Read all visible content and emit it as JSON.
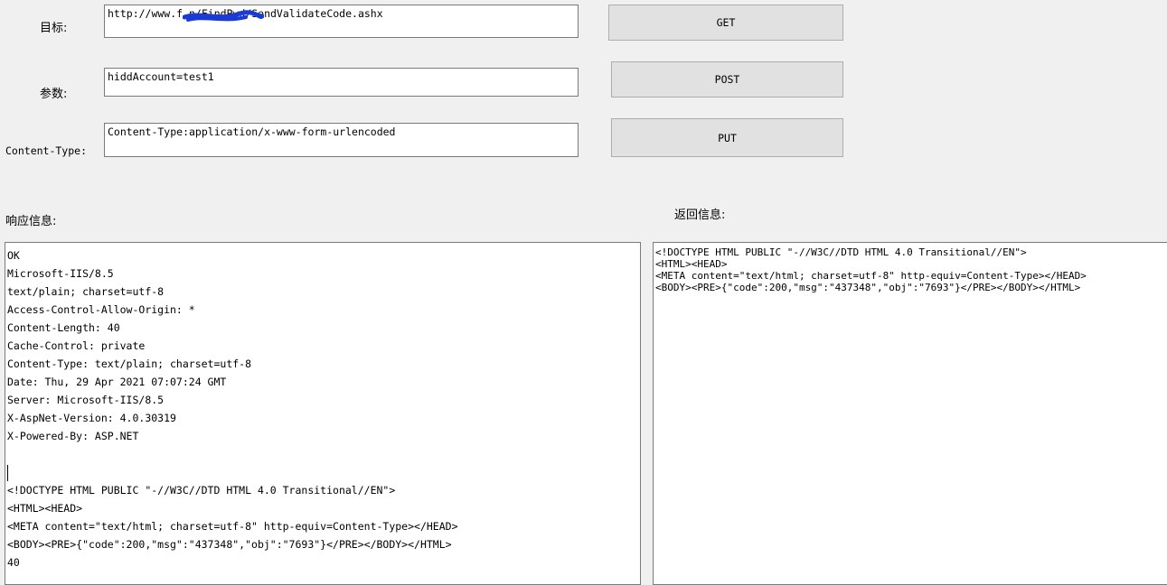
{
  "form": {
    "target_label": "目标:",
    "target_value": "http://www.f        n/FindPwd/SendValidateCode.ashx",
    "params_label": "参数:",
    "params_value": "hiddAccount=test1",
    "content_type_label": "Content-Type:",
    "content_type_value": "Content-Type:application/x-www-form-urlencoded"
  },
  "buttons": {
    "get": "GET",
    "post": "POST",
    "put": "PUT"
  },
  "response": {
    "label": "响应信息:",
    "lines": [
      "OK",
      "Microsoft-IIS/8.5",
      "text/plain; charset=utf-8",
      "Access-Control-Allow-Origin: *",
      "Content-Length: 40",
      "Cache-Control: private",
      "Content-Type: text/plain; charset=utf-8",
      "Date: Thu, 29 Apr 2021 07:07:24 GMT",
      "Server: Microsoft-IIS/8.5",
      "X-AspNet-Version: 4.0.30319",
      "X-Powered-By: ASP.NET",
      "",
      "",
      "<!DOCTYPE HTML PUBLIC \"-//W3C//DTD HTML 4.0 Transitional//EN\">",
      "<HTML><HEAD>",
      "<META content=\"text/html; charset=utf-8\" http-equiv=Content-Type></HEAD>",
      "<BODY><PRE>{\"code\":200,\"msg\":\"437348\",\"obj\":\"7693\"}</PRE></BODY></HTML>",
      "40"
    ]
  },
  "returned": {
    "label": "返回信息:",
    "lines": [
      "<!DOCTYPE HTML PUBLIC \"-//W3C//DTD HTML 4.0 Transitional//EN\">",
      "<HTML><HEAD>",
      "<META content=\"text/html; charset=utf-8\" http-equiv=Content-Type></HEAD>",
      "<BODY><PRE>{\"code\":200,\"msg\":\"437348\",\"obj\":\"7693\"}</PRE></BODY></HTML>"
    ]
  },
  "colors": {
    "window_bg": "#f0f0f0",
    "button_bg": "#e1e1e1",
    "redaction": "#1a3bd6"
  }
}
